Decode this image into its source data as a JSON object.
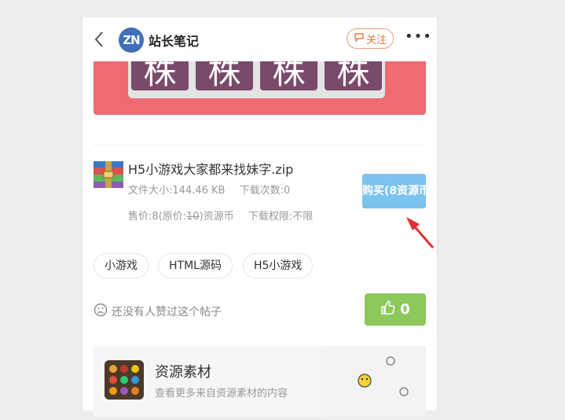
{
  "header": {
    "avatar_text": "ZN",
    "site_name": "站长笔记",
    "follow_label": "关注",
    "more_label": "•••"
  },
  "banner": {
    "tile_char": "株"
  },
  "file": {
    "name": "H5小游戏大家都来找妹字.zip",
    "size_label": "文件大小:144.46 KB",
    "downloads_label": "下载次数:0",
    "price_prefix": "售价:8(原价:",
    "price_original": "10",
    "price_suffix": ")资源币",
    "permission_label": "下载权限:不限",
    "buy_label": "购买(8资源币)"
  },
  "tags": [
    "小游戏",
    "HTML源码",
    "H5小游戏"
  ],
  "likes": {
    "empty_text": "还没有人赞过这个帖子",
    "count": "0"
  },
  "footer": {
    "title": "资源素材",
    "subtitle": "查看更多来自资源素材的内容"
  },
  "colors": {
    "banner": "#f06a71",
    "tile": "#7a4a6b",
    "buy_button": "#7cc3ee",
    "like_button": "#8bc95a",
    "follow": "#e07a45",
    "arrow": "#e03030"
  }
}
